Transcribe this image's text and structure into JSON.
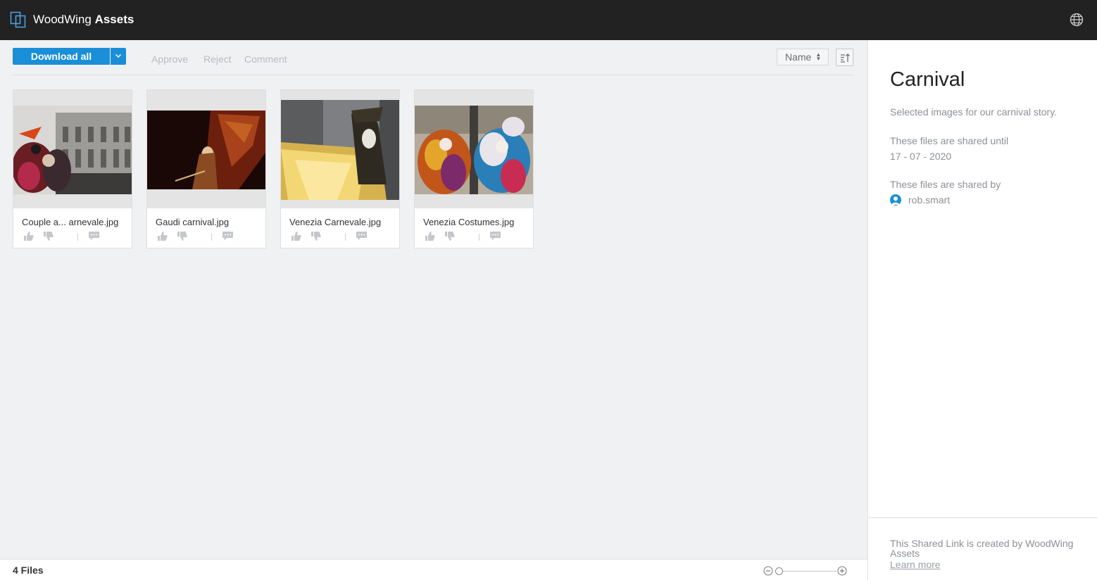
{
  "header": {
    "brand_light": "WoodWing",
    "brand_bold": "Assets",
    "logo_icon": "woodwing-logo-icon",
    "language_icon": "globe-icon"
  },
  "toolbar": {
    "download_all_label": "Download all",
    "approve_label": "Approve",
    "reject_label": "Reject",
    "comment_label": "Comment",
    "sort_field": "Name",
    "accent_color": "#1a8fd8"
  },
  "files": [
    {
      "name": "Couple a... arnevale.jpg"
    },
    {
      "name": "Gaudi carnival.jpg"
    },
    {
      "name": "Venezia Carnevale.jpg"
    },
    {
      "name": "Venezia Costumes.jpg"
    }
  ],
  "footer": {
    "files_count": "4 Files"
  },
  "side": {
    "title": "Carnival",
    "description": "Selected images for our carnival story.",
    "shared_until_label": "These files are shared until",
    "shared_until_date": "17 - 07 - 2020",
    "shared_by_label": "These files are shared by",
    "shared_by_user": "rob.smart",
    "footer_text": "This Shared Link is created by WoodWing Assets",
    "learn_more": "Learn more"
  }
}
